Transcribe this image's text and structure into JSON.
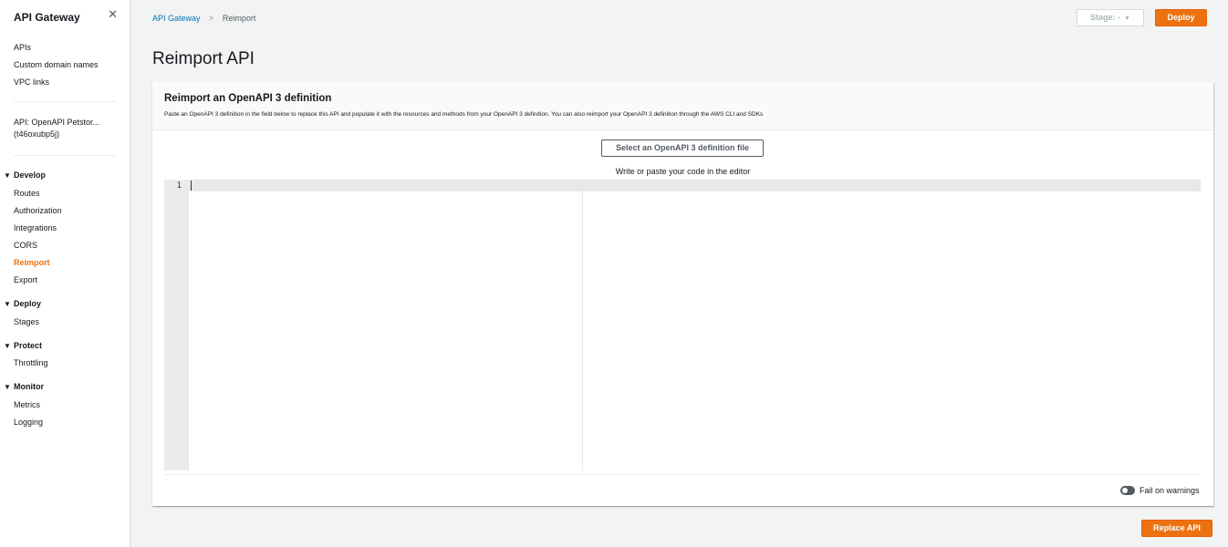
{
  "sidebar": {
    "title": "API Gateway",
    "close_icon": "close-icon",
    "top_links": [
      {
        "label": "APIs"
      },
      {
        "label": "Custom domain names"
      },
      {
        "label": "VPC links"
      }
    ],
    "api_name": "API: OpenAPI Petstor...",
    "api_id": "(t46oxubp5j)",
    "sections": [
      {
        "label": "Develop",
        "items": [
          "Routes",
          "Authorization",
          "Integrations",
          "CORS",
          "Reimport",
          "Export"
        ]
      },
      {
        "label": "Deploy",
        "items": [
          "Stages"
        ]
      },
      {
        "label": "Protect",
        "items": [
          "Throttling"
        ]
      },
      {
        "label": "Monitor",
        "items": [
          "Metrics",
          "Logging"
        ]
      }
    ],
    "active_item": "Reimport"
  },
  "breadcrumb": {
    "root": "API Gateway",
    "current": "Reimport",
    "separator": ">"
  },
  "header": {
    "stage_select": "Stage: -",
    "deploy_label": "Deploy"
  },
  "page": {
    "title": "Reimport API"
  },
  "panel": {
    "title": "Reimport an OpenAPI 3 definition",
    "description": "Paste an OpenAPI 3 definition in the field below to replace this API and populate it with the resources and methods from your OpenAPI 3 definition. You can also reimport your OpenAPI 3 definition through the AWS CLI and SDKs",
    "file_button": "Select an OpenAPI 3 definition file",
    "editor_hint": "Write or paste your code in the editor",
    "line_number": "1",
    "fail_on_warnings": "Fail on warnings",
    "fail_on_warnings_enabled": false
  },
  "footer": {
    "replace_label": "Replace API"
  },
  "colors": {
    "accent": "#ec7211",
    "link": "#0073bb"
  }
}
